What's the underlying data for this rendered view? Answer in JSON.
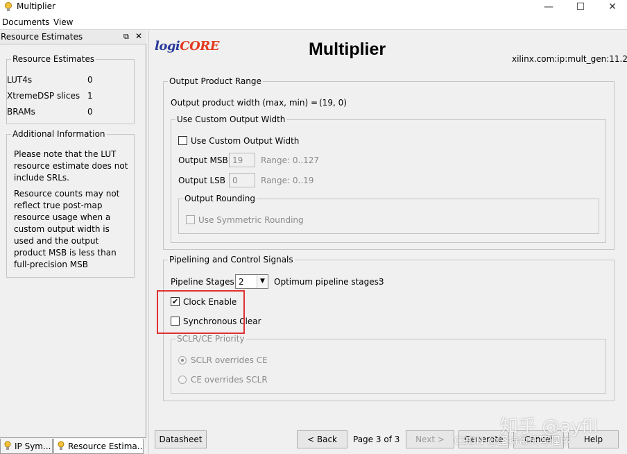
{
  "window": {
    "title": "Multiplier",
    "minimize": "—",
    "maximize": "☐",
    "close": "✕"
  },
  "menu": {
    "documents": "Documents",
    "view": "View"
  },
  "left_panel": {
    "header": "Resource Estimates",
    "resource_group": {
      "legend": "Resource Estimates",
      "rows": [
        {
          "label": "LUT4s",
          "value": "0"
        },
        {
          "label": "XtremeDSP slices",
          "value": "1"
        },
        {
          "label": "BRAMs",
          "value": "0"
        }
      ]
    },
    "info_group": {
      "legend": "Additional Information",
      "paragraphs": [
        "Please note that the LUT resource estimate does not include SRLs.",
        "Resource counts may not reflect true post-map resource usage when a custom output width is used and the output product MSB is less than full-precision MSB"
      ]
    },
    "tabs": [
      {
        "label": "IP Sym..."
      },
      {
        "label": "Resource Estima..."
      }
    ]
  },
  "header": {
    "logo_logi": "logi",
    "logo_core": "CORE",
    "title": "Multiplier",
    "ip_id": "xilinx.com:ip:mult_gen:11.2"
  },
  "output_range": {
    "legend": "Output Product Range",
    "width_label": "Output product width (max, min)  =",
    "width_value": "(19, 0)",
    "custom": {
      "legend": "Use Custom Output Width",
      "checkbox_label": "Use Custom Output Width",
      "msb_label": "Output MSB",
      "msb_value": "19",
      "msb_range": "Range: 0..127",
      "lsb_label": "Output LSB",
      "lsb_value": "0",
      "lsb_range": "Range: 0..19",
      "rounding": {
        "legend": "Output Rounding",
        "checkbox_label": "Use Symmetric Rounding"
      }
    }
  },
  "pipelining": {
    "legend": "Pipelining and Control Signals",
    "stages_label": "Pipeline Stages",
    "stages_value": "2",
    "optimum_label": "Optimum pipeline stages:",
    "optimum_value": "3",
    "clock_enable_label": "Clock Enable",
    "clock_enable_checked": true,
    "sync_clear_label": "Synchronous Clear",
    "sync_clear_checked": false,
    "priority": {
      "legend": "SCLR/CE Priority",
      "option1": "SCLR overrides CE",
      "option2": "CE overrides SCLR",
      "selected": "SCLR overrides CE"
    }
  },
  "footer": {
    "datasheet": "Datasheet",
    "back": "< Back",
    "page_indicator": "Page 3 of 3",
    "next": "Next >",
    "generate": "Generate",
    "cancel": "Cancel",
    "help": "Help"
  },
  "watermark": {
    "line1": "知乎 @ayfll",
    "line2": "CSDN @坚持每天写程序"
  },
  "colors": {
    "highlight": "#e03030",
    "logo_blue": "#2a3a9a",
    "logo_red": "#e23a1f"
  }
}
